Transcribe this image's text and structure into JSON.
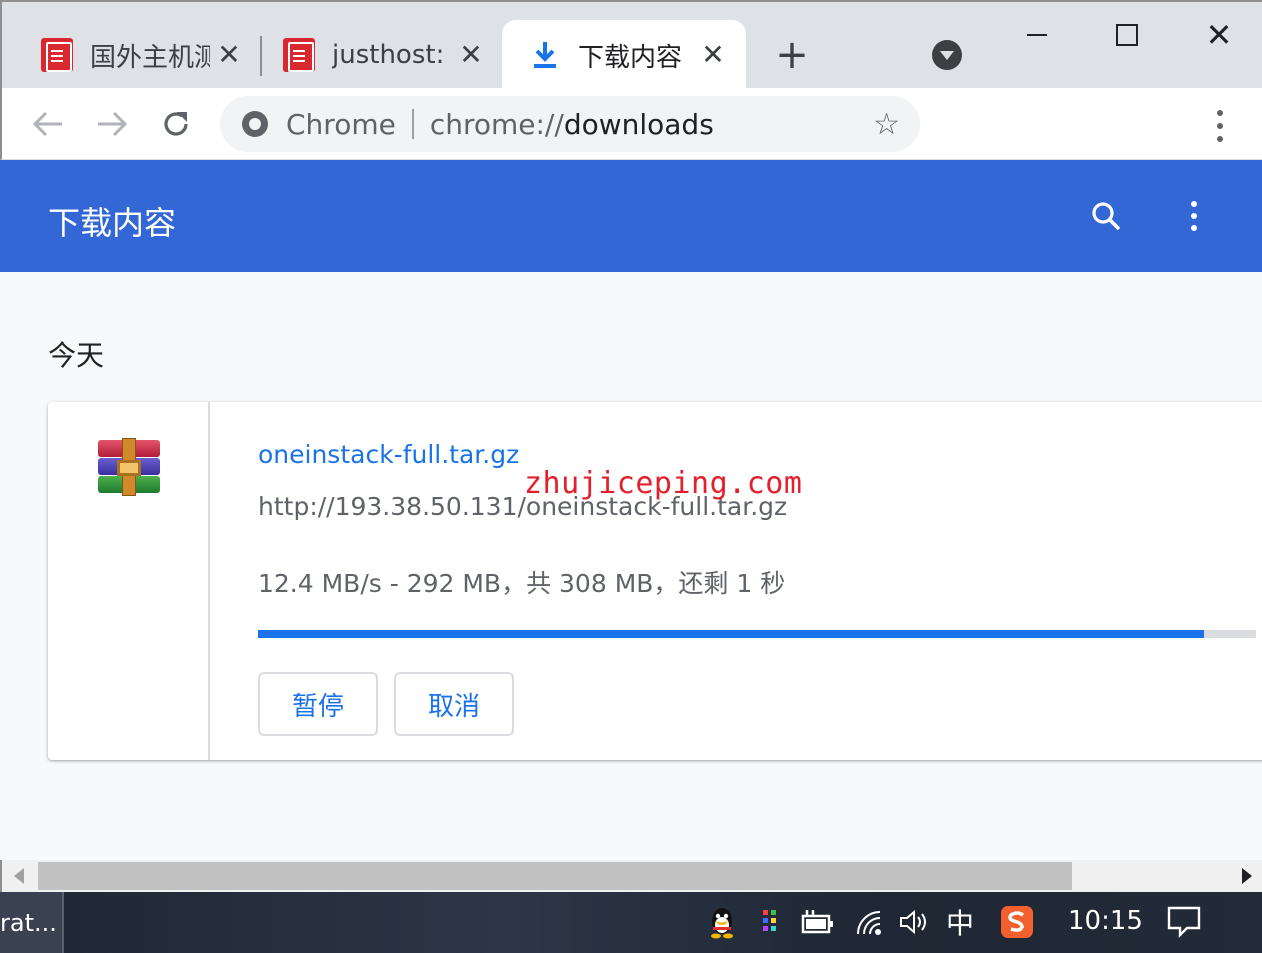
{
  "tabs": [
    {
      "title": "国外主机测",
      "close": "✕",
      "icon": "site-seal-icon"
    },
    {
      "title": "justhost:",
      "close": "✕",
      "icon": "site-seal-icon"
    },
    {
      "title": "下载内容",
      "close": "✕",
      "icon": "download-icon",
      "active": true
    }
  ],
  "new_tab": "+",
  "window_controls": {
    "close": "✕"
  },
  "omnibox": {
    "scheme_label": "Chrome",
    "url_prefix": "chrome://",
    "url_host": "downloads",
    "star": "☆"
  },
  "downloads_header": {
    "title": "下载内容"
  },
  "date_heading": "今天",
  "download_item": {
    "filename": "oneinstack-full.tar.gz",
    "url": "http://193.38.50.131/oneinstack-full.tar.gz",
    "status": "12.4 MB/s - 292 MB，共 308 MB，还剩 1 秒",
    "progress_fraction": 0.948,
    "pause_label": "暂停",
    "cancel_label": "取消"
  },
  "watermark": "zhujiceping.com",
  "taskbar": {
    "app_label": "rat...",
    "ime": "中",
    "clock": "10:15"
  },
  "colors": {
    "header_blue": "#3367d6",
    "link_blue": "#1a73e8",
    "watermark_red": "#e3202b"
  }
}
